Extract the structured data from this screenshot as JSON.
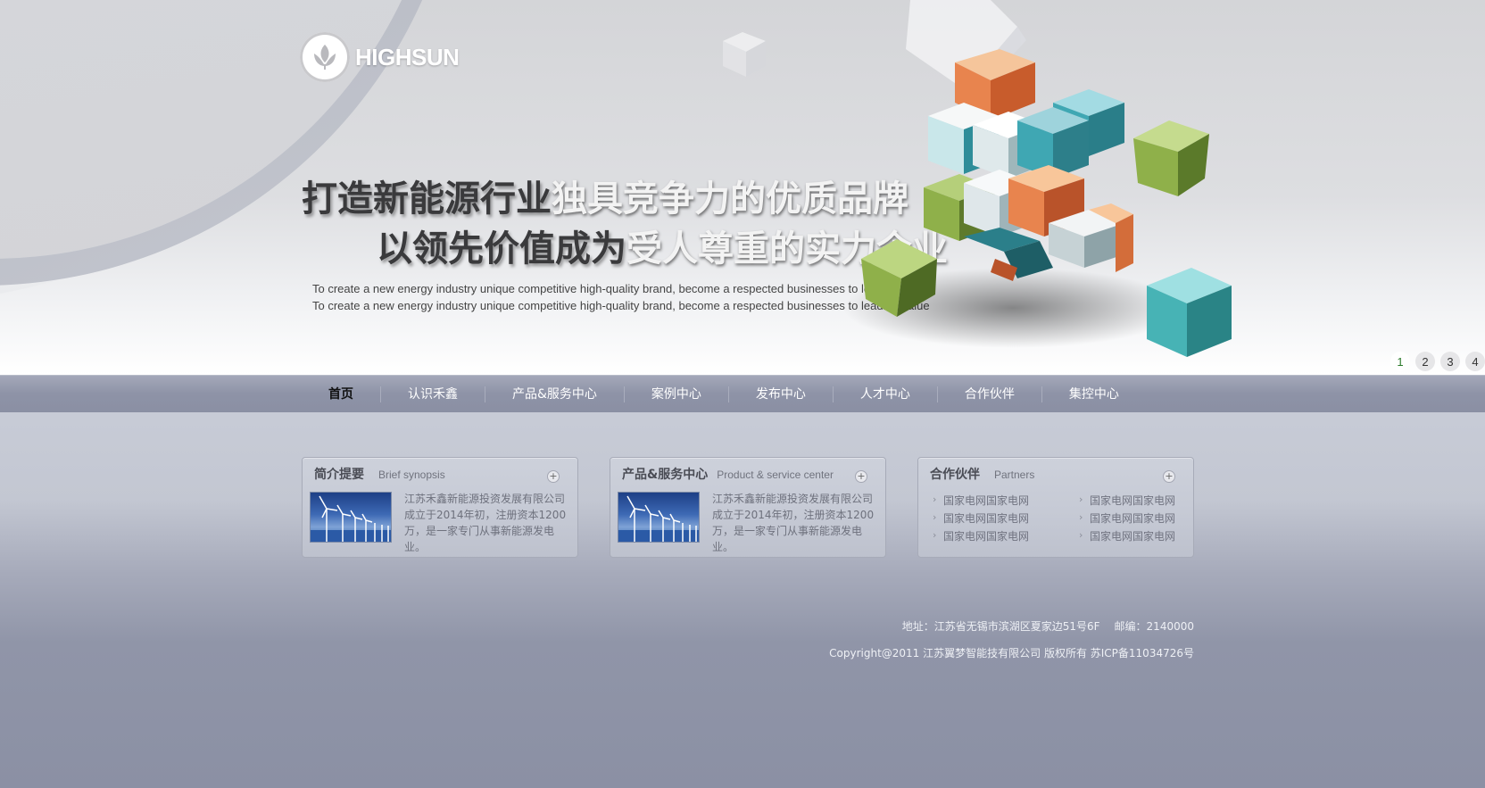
{
  "logo": {
    "text": "HIGHSUN"
  },
  "banner": {
    "slogan1_dark": "打造新能源行业",
    "slogan1_light": "独具竞争力的优质品牌",
    "slogan2_dark": "以领先价值成为",
    "slogan2_light": "受人尊重的实力企业",
    "en_line1": "To create a new energy industry unique competitive high-quality brand, become a respected businesses to leading value",
    "en_line2": "To create a new energy industry unique competitive high-quality brand, become a respected businesses to leading value",
    "pager": [
      "1",
      "2",
      "3",
      "4"
    ],
    "active_page": "1"
  },
  "nav": {
    "items": [
      "首页",
      "认识禾鑫",
      "产品&服务中心",
      "案例中心",
      "发布中心",
      "人才中心",
      "合作伙伴",
      "集控中心"
    ]
  },
  "boxes": {
    "synopsis": {
      "title": "简介提要",
      "subtitle": "Brief synopsis",
      "more": "+",
      "text": "江苏禾鑫新能源投资发展有限公司成立于2014年初，注册资本1200万，是一家专门从事新能源发电业。"
    },
    "products": {
      "title": "产品&服务中心",
      "subtitle": "Product & service center",
      "more": "+",
      "text": "江苏禾鑫新能源投资发展有限公司成立于2014年初，注册资本1200万，是一家专门从事新能源发电业。"
    },
    "partners": {
      "title": "合作伙伴",
      "subtitle": "Partners",
      "more": "+",
      "links": [
        "国家电网国家电网",
        "国家电网国家电网",
        "国家电网国家电网",
        "国家电网国家电网",
        "国家电网国家电网",
        "国家电网国家电网"
      ]
    }
  },
  "footer": {
    "address": "地址：江苏省无锡市滨湖区夏家边51号6F",
    "postcode": "邮编：2140000",
    "copyright": "Copyright@2011 江苏翼梦智能技有限公司 版权所有 苏ICP备11034726号"
  },
  "colors": {
    "nav_bg": "#8e93a7",
    "page_bg_bottom": "#8b90a4",
    "cube_green": "#8fb04a",
    "cube_teal": "#3fa7b3",
    "cube_orange": "#e8844e",
    "cube_white": "#eef1f2"
  }
}
